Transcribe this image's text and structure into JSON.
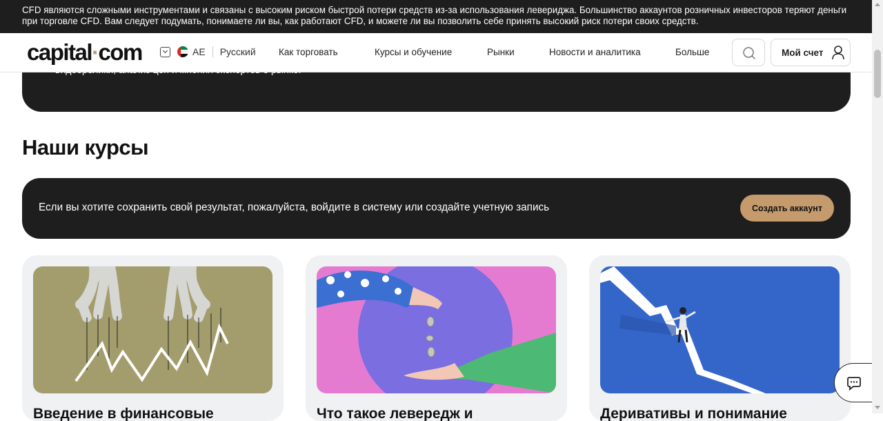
{
  "risk_warning": "CFD являются сложными инструментами и связаны с высоким риском быстрой потери средств из-за использования левериджа. Большинство аккаунтов розничных инвесторов теряют деньги при торговле CFD. Вам следует подумать, понимаете ли вы, как работают CFD, и можете ли вы позволить себе принять высокий риск потери своих средств.",
  "header": {
    "logo_part1": "capital",
    "logo_dot": "·",
    "logo_part2": "com",
    "region_code": "AE",
    "language": "Русский",
    "nav": [
      "Как торговать",
      "Курсы и обучение",
      "Рынки",
      "Новости и аналитика",
      "Больше"
    ],
    "account_label": "Мой счет"
  },
  "hero_clipped_text": "видеоролики, анализ цен и мнения экспертов о рынке.",
  "section_title": "Наши курсы",
  "login_banner": {
    "message": "Если вы хотите сохранить свой результат, пожалуйста, войдите в систему или создайте учетную запись",
    "cta": "Создать аккаунт"
  },
  "courses": [
    {
      "title": "Введение в финансовые"
    },
    {
      "title": "Что такое левередж и"
    },
    {
      "title": "Деривативы и понимание"
    }
  ],
  "colors": {
    "accent": "#c59a6d",
    "dark": "#1e1e1e",
    "card_bg": "#eff1f3"
  },
  "icons": [
    "chevron-down-icon",
    "uae-flag-icon",
    "search-icon",
    "user-icon",
    "chat-icon"
  ]
}
